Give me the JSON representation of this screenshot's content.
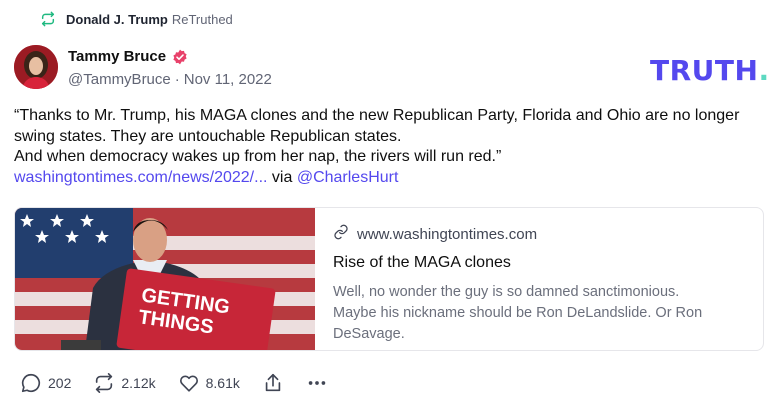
{
  "retruth": {
    "user": "Donald J. Trump",
    "action": "ReTruthed"
  },
  "author": {
    "name": "Tammy Bruce",
    "handle": "@TammyBruce",
    "date": "Nov 11, 2022"
  },
  "brand": {
    "logo_text": "TRUTH",
    "logo_dot": ".",
    "accent": "#5448ee"
  },
  "post": {
    "line1": "“Thanks to Mr. Trump, his MAGA clones and the new Republican Party, Florida and Ohio are no longer swing states. They are untouchable Republican states.",
    "line2": "And when democracy wakes up from her nap, the rivers will run red.”",
    "link": "washingtontimes.com/news/2022/...",
    "via": "via",
    "mention": "@CharlesHurt"
  },
  "card": {
    "domain": "www.washingtontimes.com",
    "title": "Rise of the MAGA clones",
    "description": "Well, no wonder the guy is so damned sanctimonious. Maybe his nickname should be Ron DeLandslide. Or Ron DeSavage.",
    "sign_text_1": "GETTING",
    "sign_text_2": "THINGS"
  },
  "actions": {
    "replies": "202",
    "retruths": "2.12k",
    "likes": "8.61k"
  },
  "icons": [
    "retruth-icon",
    "verified-icon",
    "link-icon",
    "reply-icon",
    "like-icon",
    "share-icon",
    "more-icon"
  ]
}
